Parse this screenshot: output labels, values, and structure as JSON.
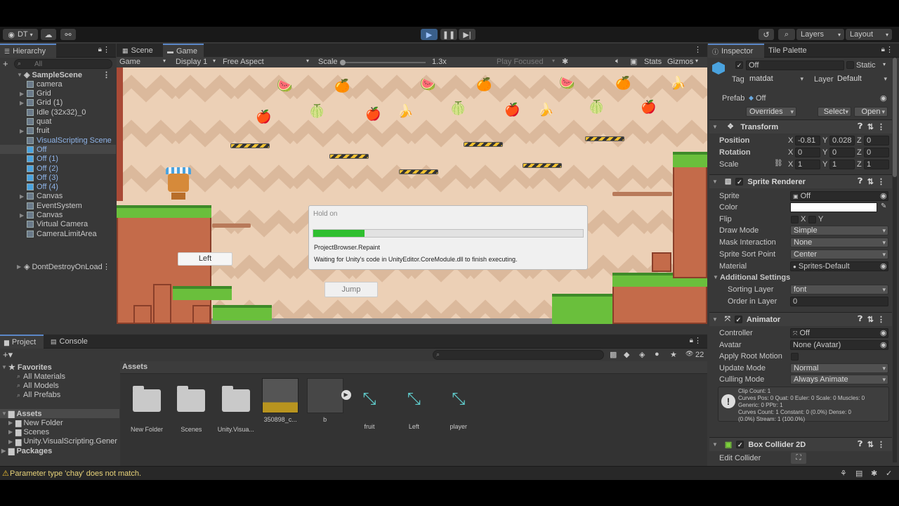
{
  "toolbar": {
    "account": "DT",
    "layers": "Layers",
    "layout": "Layout"
  },
  "hierarchy": {
    "tab": "Hierarchy",
    "search_placeholder": "All",
    "scene": "SampleScene",
    "items": [
      {
        "label": "camera"
      },
      {
        "label": "Grid"
      },
      {
        "label": "Grid (1)"
      },
      {
        "label": "Idle (32x32)_0"
      },
      {
        "label": "quat"
      },
      {
        "label": "fruit"
      },
      {
        "label": "VisualScripting Scene"
      },
      {
        "label": "Off"
      },
      {
        "label": "Off (1)"
      },
      {
        "label": "Off (2)"
      },
      {
        "label": "Off (3)"
      },
      {
        "label": "Off (4)"
      },
      {
        "label": "Canvas"
      },
      {
        "label": "EventSystem"
      },
      {
        "label": "Canvas"
      },
      {
        "label": "Virtual Camera"
      },
      {
        "label": "CameraLimitArea"
      }
    ],
    "dontdestroy": "DontDestroyOnLoad"
  },
  "scene_tabs": {
    "scene": "Scene",
    "game": "Game"
  },
  "game_bar": {
    "mode": "Game",
    "display": "Display 1",
    "aspect": "Free Aspect",
    "scale_label": "Scale",
    "scale_value": "1.3x",
    "play_focused": "Play Focused",
    "stats": "Stats",
    "gizmos": "Gizmos"
  },
  "game": {
    "left_button": "Left",
    "jump_button": "Jump"
  },
  "dialog": {
    "title": "Hold on",
    "progress": 0.19,
    "line1": "ProjectBrowser.Repaint",
    "line2": "Waiting for Unity's code in UnityEditor.CoreModule.dll to finish executing."
  },
  "inspector": {
    "tabs": [
      "Inspector",
      "Tile Palette"
    ],
    "object_name": "Off",
    "static_label": "Static",
    "tag_label": "Tag",
    "tag_value": "matdat",
    "layer_label": "Layer",
    "layer_value": "Default",
    "prefab_label": "Prefab",
    "prefab_value": "Off",
    "overrides": "Overrides",
    "select": "Select",
    "open": "Open",
    "transform": {
      "title": "Transform",
      "position_label": "Position",
      "rotation_label": "Rotation",
      "scale_label": "Scale",
      "position": {
        "x": "-0.81",
        "y": "0.028",
        "z": "0"
      },
      "rotation": {
        "x": "0",
        "y": "0",
        "z": "0"
      },
      "scale": {
        "x": "1",
        "y": "1",
        "z": "1"
      }
    },
    "sprite_renderer": {
      "title": "Sprite Renderer",
      "sprite_label": "Sprite",
      "sprite_value": "Off",
      "color_label": "Color",
      "flip_label": "Flip",
      "flip_x": "X",
      "flip_y": "Y",
      "draw_mode_label": "Draw Mode",
      "draw_mode": "Simple",
      "mask_label": "Mask Interaction",
      "mask_value": "None",
      "sort_point_label": "Sprite Sort Point",
      "sort_point": "Center",
      "material_label": "Material",
      "material_value": "Sprites-Default",
      "additional": "Additional Settings",
      "sorting_layer_label": "Sorting Layer",
      "sorting_layer": "font",
      "order_label": "Order in Layer",
      "order_value": "0"
    },
    "animator": {
      "title": "Animator",
      "controller_label": "Controller",
      "controller_value": "Off",
      "avatar_label": "Avatar",
      "avatar_value": "None (Avatar)",
      "root_motion_label": "Apply Root Motion",
      "update_label": "Update Mode",
      "update_value": "Normal",
      "culling_label": "Culling Mode",
      "culling_value": "Always Animate",
      "info_lines": [
        "Clip Count: 1",
        "Curves Pos: 0 Quat: 0 Euler: 0 Scale: 0 Muscles: 0",
        "Generic: 0 PPtr: 1",
        "Curves Count: 1 Constant: 0 (0.0%) Dense: 0",
        "(0.0%) Stream: 1 (100.0%)"
      ]
    },
    "box_collider": {
      "title": "Box Collider 2D",
      "edit_label": "Edit Collider"
    }
  },
  "project": {
    "tabs": [
      "Project",
      "Console"
    ],
    "favorites": "Favorites",
    "fav_items": [
      "All Materials",
      "All Models",
      "All Prefabs"
    ],
    "assets": "Assets",
    "asset_folders": [
      "New Folder",
      "Scenes",
      "Unity.VisualScripting.Gener"
    ],
    "packages": "Packages",
    "breadcrumb": "Assets",
    "hidden_count": "22",
    "items": [
      {
        "label": "New Folder",
        "kind": "folder"
      },
      {
        "label": "Scenes",
        "kind": "folder"
      },
      {
        "label": "Unity.Visua...",
        "kind": "folder"
      },
      {
        "label": "350898_c...",
        "kind": "image"
      },
      {
        "label": "b",
        "kind": "sprite"
      },
      {
        "label": "fruit",
        "kind": "anim"
      },
      {
        "label": "Left",
        "kind": "anim"
      },
      {
        "label": "player",
        "kind": "anim"
      }
    ]
  },
  "status": {
    "message": "Parameter type 'chay' does not match."
  },
  "colors": {
    "accent": "#5b87c7",
    "progress": "#2fbf2f",
    "game_bg": "#e8c9ac",
    "grass": "#6abf3c"
  }
}
